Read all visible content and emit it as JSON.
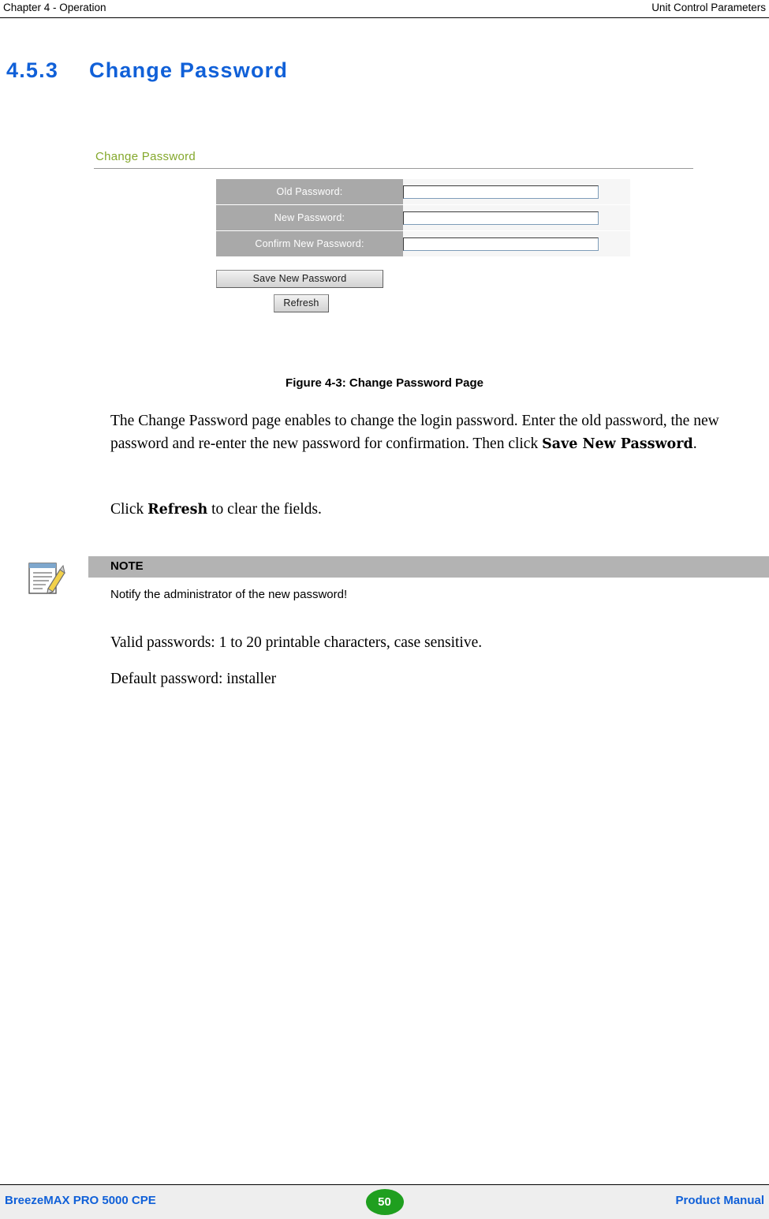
{
  "header": {
    "left": "Chapter 4 - Operation",
    "right": "Unit Control Parameters"
  },
  "section": {
    "number": "4.5.3",
    "title": "Change Password"
  },
  "figure": {
    "ui_title": "Change Password",
    "fields": [
      {
        "label": "Old Password:",
        "value": ""
      },
      {
        "label": "New Password:",
        "value": ""
      },
      {
        "label": "Confirm New Password:",
        "value": ""
      }
    ],
    "save_button": "Save New Password",
    "refresh_button": "Refresh",
    "caption": "Figure 4-3: Change Password Page"
  },
  "body": {
    "para1_a": "The Change Password page enables to change the login password. Enter the old password, the new password and re-enter the new password for confirmation. Then click ",
    "para1_bold": "Save New Password",
    "para1_b": ".",
    "para2_a": "Click ",
    "para2_bold": "Refresh",
    "para2_b": " to clear the fields.",
    "para3": "Valid passwords: 1 to 20 printable characters, case sensitive.",
    "para4": "Default password: installer"
  },
  "note": {
    "title": "NOTE",
    "text": "Notify the administrator of the new password!"
  },
  "footer": {
    "left": "BreezeMAX PRO 5000 CPE",
    "page": "50",
    "right": "Product Manual"
  },
  "colors": {
    "heading_blue": "#1060d8",
    "ui_title_green": "#84a82c",
    "label_gray": "#a9a9a9",
    "note_bar_gray": "#b3b3b3",
    "page_badge_green": "#1f9f1f"
  }
}
